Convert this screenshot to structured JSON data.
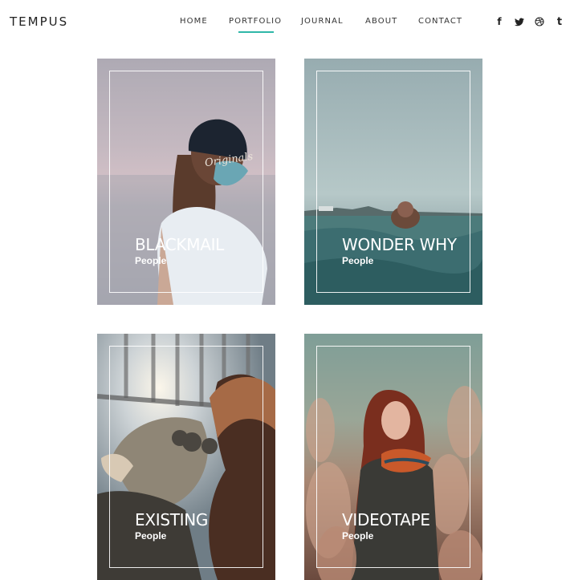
{
  "site": {
    "logo": "TEMPUS"
  },
  "nav": {
    "items": [
      {
        "label": "HOME",
        "active": false
      },
      {
        "label": "PORTFOLIO",
        "active": true
      },
      {
        "label": "JOURNAL",
        "active": false
      },
      {
        "label": "ABOUT",
        "active": false
      },
      {
        "label": "CONTACT",
        "active": false
      }
    ],
    "accent_color": "#2fb7a8"
  },
  "social": [
    {
      "label": "f",
      "icon": "facebook-icon"
    },
    {
      "label": "🐦",
      "icon": "twitter-icon"
    },
    {
      "label": "◎",
      "icon": "dribbble-icon"
    },
    {
      "label": "t",
      "icon": "tumblr-icon"
    }
  ],
  "portfolio": {
    "items": [
      {
        "title": "BLACKMAIL",
        "category": "People"
      },
      {
        "title": "WONDER WHY",
        "category": "People"
      },
      {
        "title": "EXISTING",
        "category": "People"
      },
      {
        "title": "VIDEOTAPE",
        "category": "People"
      }
    ]
  }
}
